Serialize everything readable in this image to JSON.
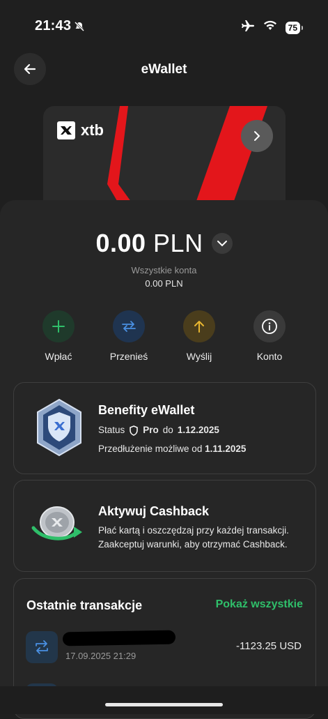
{
  "status_bar": {
    "time": "21:43",
    "battery": "75"
  },
  "header": {
    "title": "eWallet"
  },
  "card": {
    "brand": "xtb"
  },
  "balance": {
    "amount": "0.00",
    "currency": "PLN",
    "all_accounts_label": "Wszystkie konta",
    "all_accounts_value": "0.00 PLN"
  },
  "actions": [
    {
      "label": "Wpłać",
      "icon": "plus-icon",
      "color": "#2f9e5b"
    },
    {
      "label": "Przenieś",
      "icon": "transfer-arrows-icon",
      "color": "#3a7bd5"
    },
    {
      "label": "Wyślij",
      "icon": "arrow-up-icon",
      "color": "#e0b030"
    },
    {
      "label": "Konto",
      "icon": "info-icon",
      "color": "#3a3a3a"
    }
  ],
  "benefits": {
    "title": "Benefity eWallet",
    "status_label": "Status",
    "tier": "Pro",
    "until_label": "do",
    "until_date": "1.12.2025",
    "extension_label": "Przedłużenie możliwe od",
    "extension_date": "1.11.2025"
  },
  "cashback": {
    "title": "Aktywuj Cashback",
    "text_line1": "Płać kartą i oszczędzaj przy każdej transakcji.",
    "text_line2": "Zaakceptuj warunki, aby otrzymać Cashback."
  },
  "transactions": {
    "title": "Ostatnie transakcje",
    "show_all": "Pokaż wszystkie",
    "items": [
      {
        "date": "17.09.2025 21:29",
        "amount": "-1123.25 USD"
      }
    ]
  },
  "colors": {
    "accent_green": "#2fbf6a",
    "brand_red": "#e3161b",
    "background": "#1f1f1f"
  }
}
